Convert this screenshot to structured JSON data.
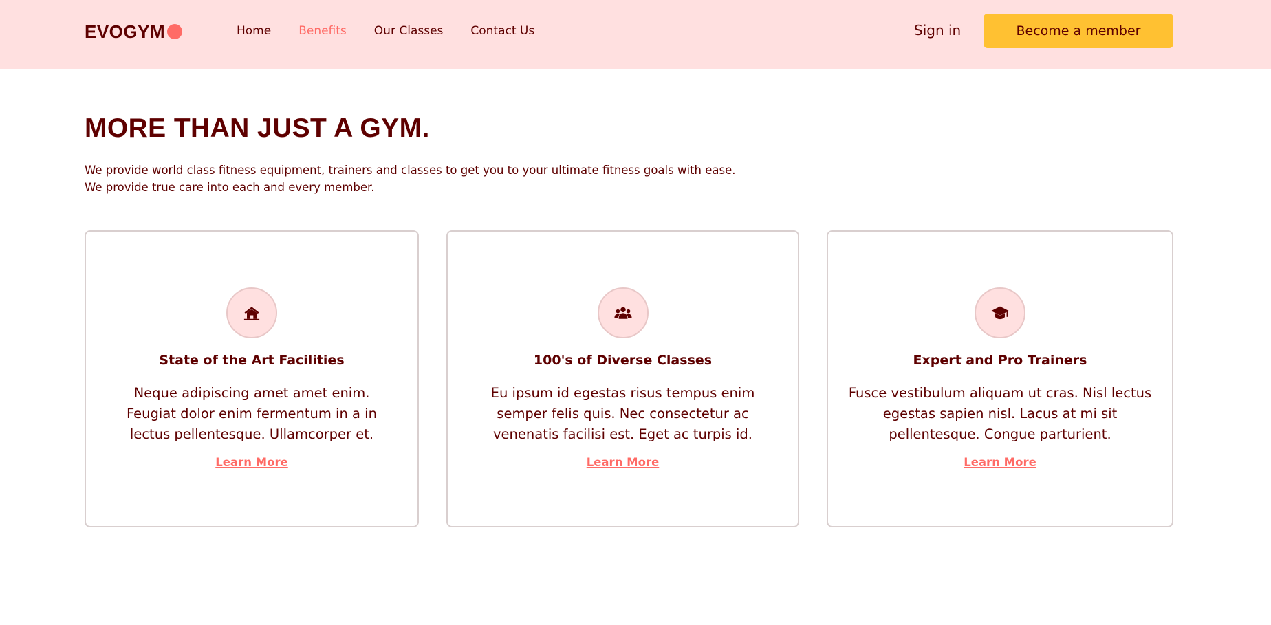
{
  "nav": {
    "logo": "EVOGYM",
    "links": [
      {
        "label": "Home",
        "active": false
      },
      {
        "label": "Benefits",
        "active": true
      },
      {
        "label": "Our Classes",
        "active": false
      },
      {
        "label": "Contact Us",
        "active": false
      }
    ],
    "sign_in": "Sign in",
    "cta": "Become a member"
  },
  "benefits": {
    "title": "MORE THAN JUST A GYM.",
    "description": "We provide world class fitness equipment, trainers and classes to get you to your ultimate fitness goals with ease. We provide true care into each and every member.",
    "cards": [
      {
        "icon": "home-icon",
        "title": "State of the Art Facilities",
        "text": "Neque adipiscing amet amet enim. Feugiat dolor enim fermentum in a in lectus pellentesque. Ullamcorper et.",
        "link": "Learn More"
      },
      {
        "icon": "user-group-icon",
        "title": "100's of Diverse Classes",
        "text": "Eu ipsum id egestas risus tempus enim semper felis quis. Nec consectetur ac venenatis facilisi est. Eget ac turpis id.",
        "link": "Learn More"
      },
      {
        "icon": "academic-cap-icon",
        "title": "Expert and Pro Trainers",
        "text": "Fusce vestibulum aliquam ut cras. Nisl lectus egestas sapien nisl. Lacus at mi sit pellentesque. Congue parturient.",
        "link": "Learn More"
      }
    ]
  },
  "colors": {
    "primary": "#5e0000",
    "accent": "#ff6b66",
    "nav_bg": "#ffe0e0",
    "button": "#ffc132"
  }
}
